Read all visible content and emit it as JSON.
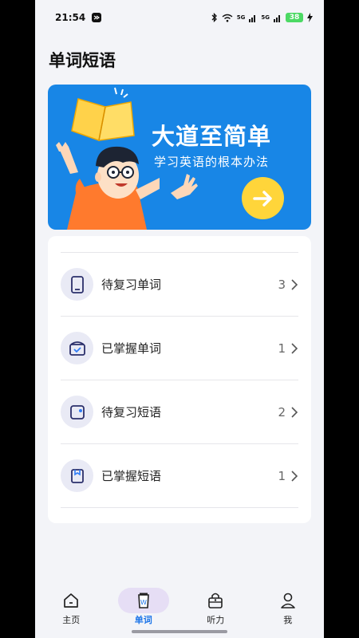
{
  "status": {
    "time": "21:54",
    "network1": "5G",
    "network2": "5G",
    "battery": "38"
  },
  "page": {
    "title": "单词短语"
  },
  "banner": {
    "title": "大道至简单",
    "subtitle": "学习英语的根本办法",
    "colors": {
      "background": "#1886e6",
      "button": "#ffd53a"
    }
  },
  "list": [
    {
      "label": "待复习单词",
      "count": "3",
      "icon": "phone-icon"
    },
    {
      "label": "已掌握单词",
      "count": "1",
      "icon": "checked-box-icon"
    },
    {
      "label": "待复习短语",
      "count": "2",
      "icon": "wallet-icon"
    },
    {
      "label": "已掌握短语",
      "count": "1",
      "icon": "bookmark-icon"
    }
  ],
  "tabs": [
    {
      "label": "主页",
      "icon": "home-icon"
    },
    {
      "label": "单词",
      "icon": "word-cup-icon",
      "active": true
    },
    {
      "label": "听力",
      "icon": "lock-radio-icon"
    },
    {
      "label": "我",
      "icon": "person-icon"
    }
  ],
  "accent": "#1a73e8"
}
